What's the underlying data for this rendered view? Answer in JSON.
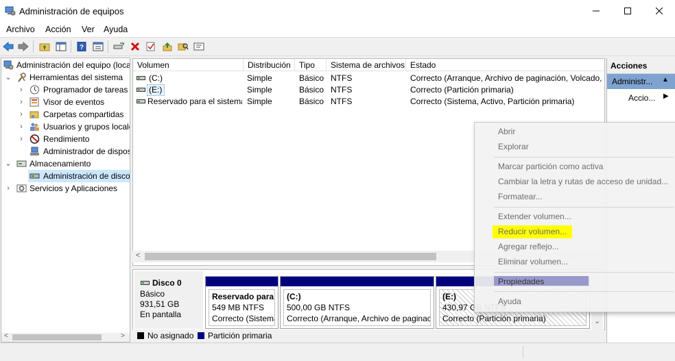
{
  "window": {
    "title": "Administración de equipos"
  },
  "menubar": [
    "Archivo",
    "Acción",
    "Ver",
    "Ayuda"
  ],
  "tree": {
    "root": "Administración del equipo (local)",
    "system_tools": "Herramientas del sistema",
    "task_scheduler": "Programador de tareas",
    "event_viewer": "Visor de eventos",
    "shared_folders": "Carpetas compartidas",
    "users_groups": "Usuarios y grupos locales",
    "performance": "Rendimiento",
    "device_manager": "Administrador de dispositivos",
    "storage": "Almacenamiento",
    "disk_mgmt": "Administración de discos",
    "services_apps": "Servicios y Aplicaciones"
  },
  "volumes": {
    "columns": [
      "Volumen",
      "Distribución",
      "Tipo",
      "Sistema de archivos",
      "Estado"
    ],
    "rows": [
      [
        "(C:)",
        "Simple",
        "Básico",
        "NTFS",
        "Correcto (Arranque, Archivo de paginación, Volcado, Partición primaria)"
      ],
      [
        "(E:)",
        "Simple",
        "Básico",
        "NTFS",
        "Correcto (Partición primaria)"
      ],
      [
        "Reservado para el sistema",
        "Simple",
        "Básico",
        "NTFS",
        "Correcto (Sistema, Activo, Partición primaria)"
      ]
    ]
  },
  "disk": {
    "name": "Disco 0",
    "type": "Básico",
    "size": "931,51 GB",
    "state": "En pantalla",
    "partitions": [
      {
        "title": "Reservado para e",
        "size": "549 MB NTFS",
        "status": "Correcto (Sistema"
      },
      {
        "title": "(C:)",
        "size": "500,00 GB NTFS",
        "status": "Correcto (Arranque, Archivo de paginac"
      },
      {
        "title": "(E:)",
        "size": "430,97 GB NTFS",
        "status": "Correcto (Partición primaria)"
      }
    ]
  },
  "legend": {
    "unallocated": "No asignado",
    "primary": "Partición primaria"
  },
  "actions": {
    "header": "Acciones",
    "group": "Administr...",
    "more": "Accio..."
  },
  "context_menu": {
    "open": "Abrir",
    "explore": "Explorar",
    "mark_active": "Marcar partición como activa",
    "change_letter": "Cambiar la letra y rutas de acceso de unidad...",
    "format": "Formatear...",
    "extend": "Extender volumen...",
    "shrink": "Reducir volumen...",
    "mirror": "Agregar reflejo...",
    "delete": "Eliminar volumen...",
    "properties": "Propiedades",
    "help": "Ayuda"
  },
  "colors": {
    "primary_partition": "#00007f",
    "highlight": "#ffff00",
    "menu_selected": "#9999cc"
  }
}
